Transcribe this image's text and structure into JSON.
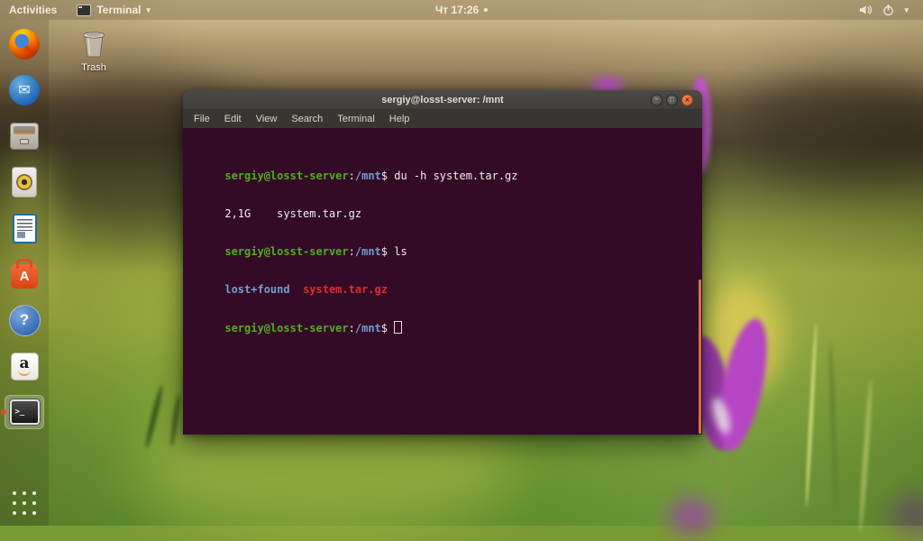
{
  "top_bar": {
    "activities_label": "Activities",
    "app_name": "Terminal",
    "app_caret": "▾",
    "clock": "Чт 17:26",
    "menu_caret": "▾"
  },
  "desktop": {
    "trash_label": "Trash"
  },
  "dock": {
    "thunderbird_glyph": "✉",
    "software_glyph": "A",
    "help_glyph": "?",
    "amazon_glyph": "a",
    "terminal_glyph": ">_",
    "items": [
      "firefox",
      "thunderbird",
      "files",
      "rhythmbox",
      "libreoffice-writer",
      "ubuntu-software",
      "help",
      "amazon",
      "terminal",
      "show-applications"
    ],
    "active_item": "terminal"
  },
  "window": {
    "title": "sergiy@losst-server: /mnt",
    "minimize_glyph": "−",
    "maximize_glyph": "□",
    "close_glyph": "×",
    "menu": [
      "File",
      "Edit",
      "View",
      "Search",
      "Terminal",
      "Help"
    ]
  },
  "terminal": {
    "prompt": {
      "user": "sergiy@losst-server",
      "colon": ":",
      "path": "/mnt",
      "dollar": "$ "
    },
    "command_du": "du -h system.tar.gz",
    "du_output": "2,1G    system.tar.gz",
    "command_ls": "ls",
    "ls_dir": "lost+found",
    "ls_sep": "  ",
    "ls_file": "system.tar.gz",
    "colors": {
      "background": "#330b27",
      "prompt_green": "#52ad21",
      "path_blue": "#729fcf",
      "file_red": "#e32b2b",
      "text": "#f2ebee",
      "cursor_outline": "#eed7dc",
      "scrollbar_orange": "#d56f42",
      "close_button": "#dd5b28"
    }
  }
}
